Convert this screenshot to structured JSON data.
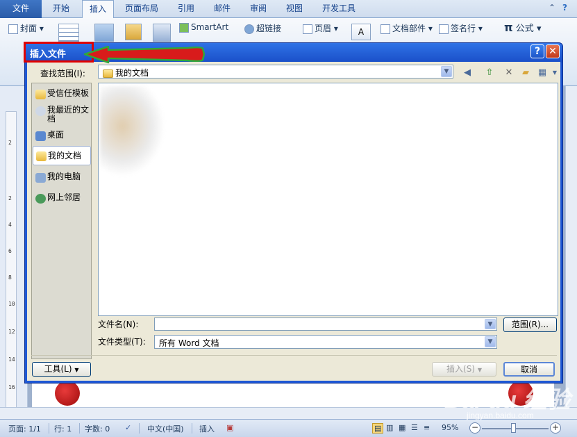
{
  "ribbon": {
    "tabs": [
      {
        "label": "文件"
      },
      {
        "label": "开始"
      },
      {
        "label": "插入"
      },
      {
        "label": "页面布局"
      },
      {
        "label": "引用"
      },
      {
        "label": "邮件"
      },
      {
        "label": "审阅"
      },
      {
        "label": "视图"
      },
      {
        "label": "开发工具"
      }
    ],
    "active_tab": "插入",
    "groups": {
      "cover": "封面",
      "smartart": "SmartArt",
      "hyperlink": "超链接",
      "header": "页眉",
      "doc_parts": "文档部件",
      "signature": "签名行",
      "equation": "公式",
      "equation_symbol": "π"
    }
  },
  "dialog": {
    "title": "插入文件",
    "help_label": "?",
    "close_label": "✕",
    "look_in_label": "查找范围(I):",
    "look_in_value": "我的文档",
    "places": [
      {
        "label": "受信任模板",
        "icon": "folder-icon"
      },
      {
        "label": "我最近的文档",
        "icon": "recent-documents-icon"
      },
      {
        "label": "桌面",
        "icon": "desktop-icon"
      },
      {
        "label": "我的文档",
        "icon": "my-documents-icon"
      },
      {
        "label": "我的电脑",
        "icon": "my-computer-icon"
      },
      {
        "label": "网上邻居",
        "icon": "network-icon"
      }
    ],
    "selected_place": "我的文档",
    "filename_label": "文件名(N):",
    "filename_value": "",
    "filetype_label": "文件类型(T):",
    "filetype_value": "所有 Word 文档",
    "range_button": "范围(R)...",
    "tools_button": "工具(L)",
    "insert_button": "插入(S)",
    "cancel_button": "取消"
  },
  "statusbar": {
    "page": "页面: 1/1",
    "line": "行: 1",
    "word_count": "字数: 0",
    "language": "中文(中国)",
    "mode": "插入",
    "zoom": "95%"
  },
  "ruler_marks": [
    "2",
    "2",
    "4",
    "6",
    "8",
    "10",
    "12",
    "14",
    "16"
  ],
  "watermark": {
    "brand": "Bai du 经验",
    "url": "jingyan.baidu.com"
  },
  "colors": {
    "dialog_title_bg": "#1d57d4",
    "dialog_body_bg": "#ece9d8",
    "annotation_red": "#e00000",
    "annotation_arrow_green": "#2fa83a",
    "ribbon_file_tab": "#2a5ca8"
  }
}
